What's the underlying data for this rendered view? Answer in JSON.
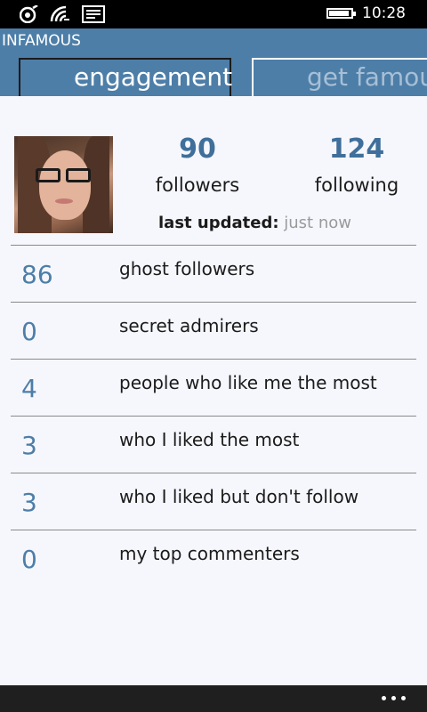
{
  "status_bar": {
    "time": "10:28",
    "icons": [
      "signal-icon",
      "wifi-icon",
      "message-icon"
    ],
    "battery": 0.85
  },
  "app": {
    "title": "INFAMOUS",
    "tabs": [
      {
        "label": "engagement",
        "active": true
      },
      {
        "label": "get famous",
        "active": false
      }
    ]
  },
  "profile": {
    "followers_count": "90",
    "followers_label": "followers",
    "following_count": "124",
    "following_label": "following",
    "updated_label": "last updated:",
    "updated_value": "just now"
  },
  "stats": [
    {
      "value": "86",
      "label": "ghost followers"
    },
    {
      "value": "0",
      "label": "secret admirers"
    },
    {
      "value": "4",
      "label": "people who like me the most"
    },
    {
      "value": "3",
      "label": "who I liked the most"
    },
    {
      "value": "3",
      "label": "who I liked but don't follow"
    },
    {
      "value": "0",
      "label": "my top commenters"
    }
  ],
  "colors": {
    "accent": "#4d7ea8",
    "number": "#3f6f9a",
    "background": "#f5f7fd"
  }
}
